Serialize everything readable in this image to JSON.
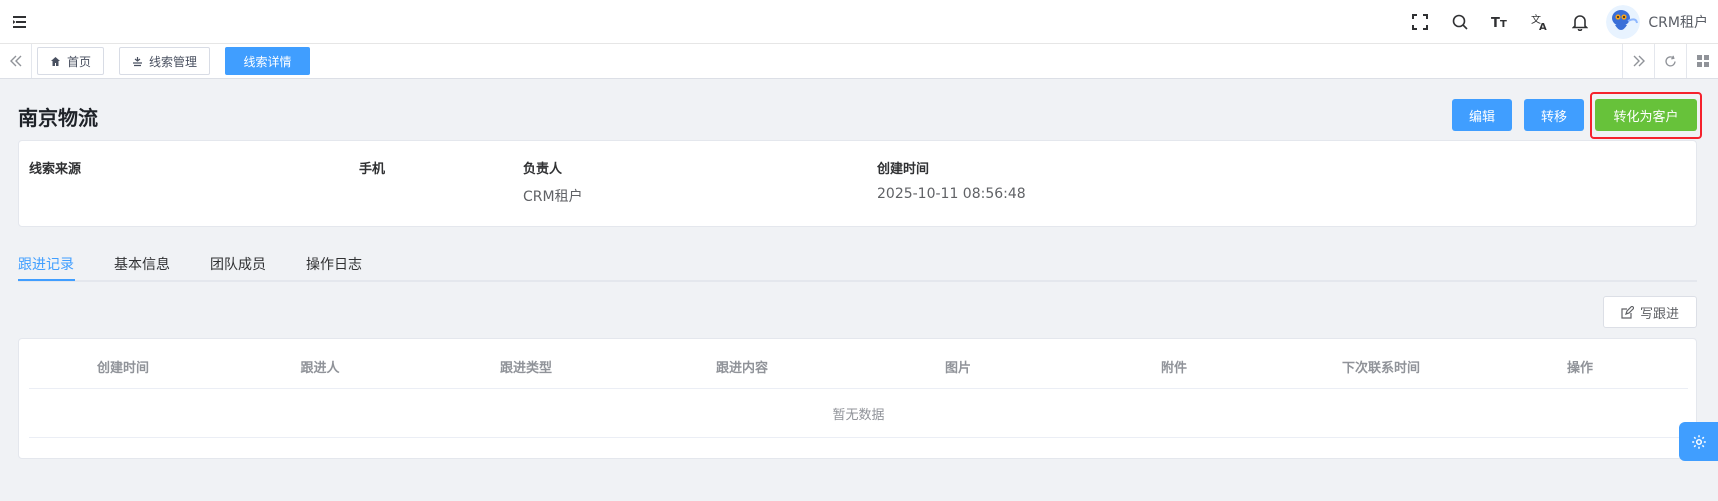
{
  "user": {
    "name": "CRM租户"
  },
  "tags": [
    {
      "label": "首页",
      "icon": "home-icon"
    },
    {
      "label": "线索管理",
      "icon": "clue-icon"
    },
    {
      "label": "线索详情",
      "active": true
    }
  ],
  "header": {
    "title": "南京物流",
    "edit_label": "编辑",
    "transfer_label": "转移",
    "convert_label": "转化为客户"
  },
  "info": {
    "fields": [
      {
        "label": "线索来源",
        "value": ""
      },
      {
        "label": "手机",
        "value": ""
      },
      {
        "label": "负责人",
        "value": "CRM租户"
      },
      {
        "label": "创建时间",
        "value": "2025-10-11 08:56:48"
      }
    ]
  },
  "tabs": [
    {
      "label": "跟进记录",
      "active": true
    },
    {
      "label": "基本信息"
    },
    {
      "label": "团队成员"
    },
    {
      "label": "操作日志"
    }
  ],
  "write_followup_label": "写跟进",
  "table": {
    "columns": [
      "创建时间",
      "跟进人",
      "跟进类型",
      "跟进内容",
      "图片",
      "附件",
      "下次联系时间",
      "操作"
    ],
    "empty_text": "暂无数据"
  },
  "colors": {
    "primary": "#409eff",
    "success": "#67c23a",
    "highlight": "#f5222d"
  }
}
